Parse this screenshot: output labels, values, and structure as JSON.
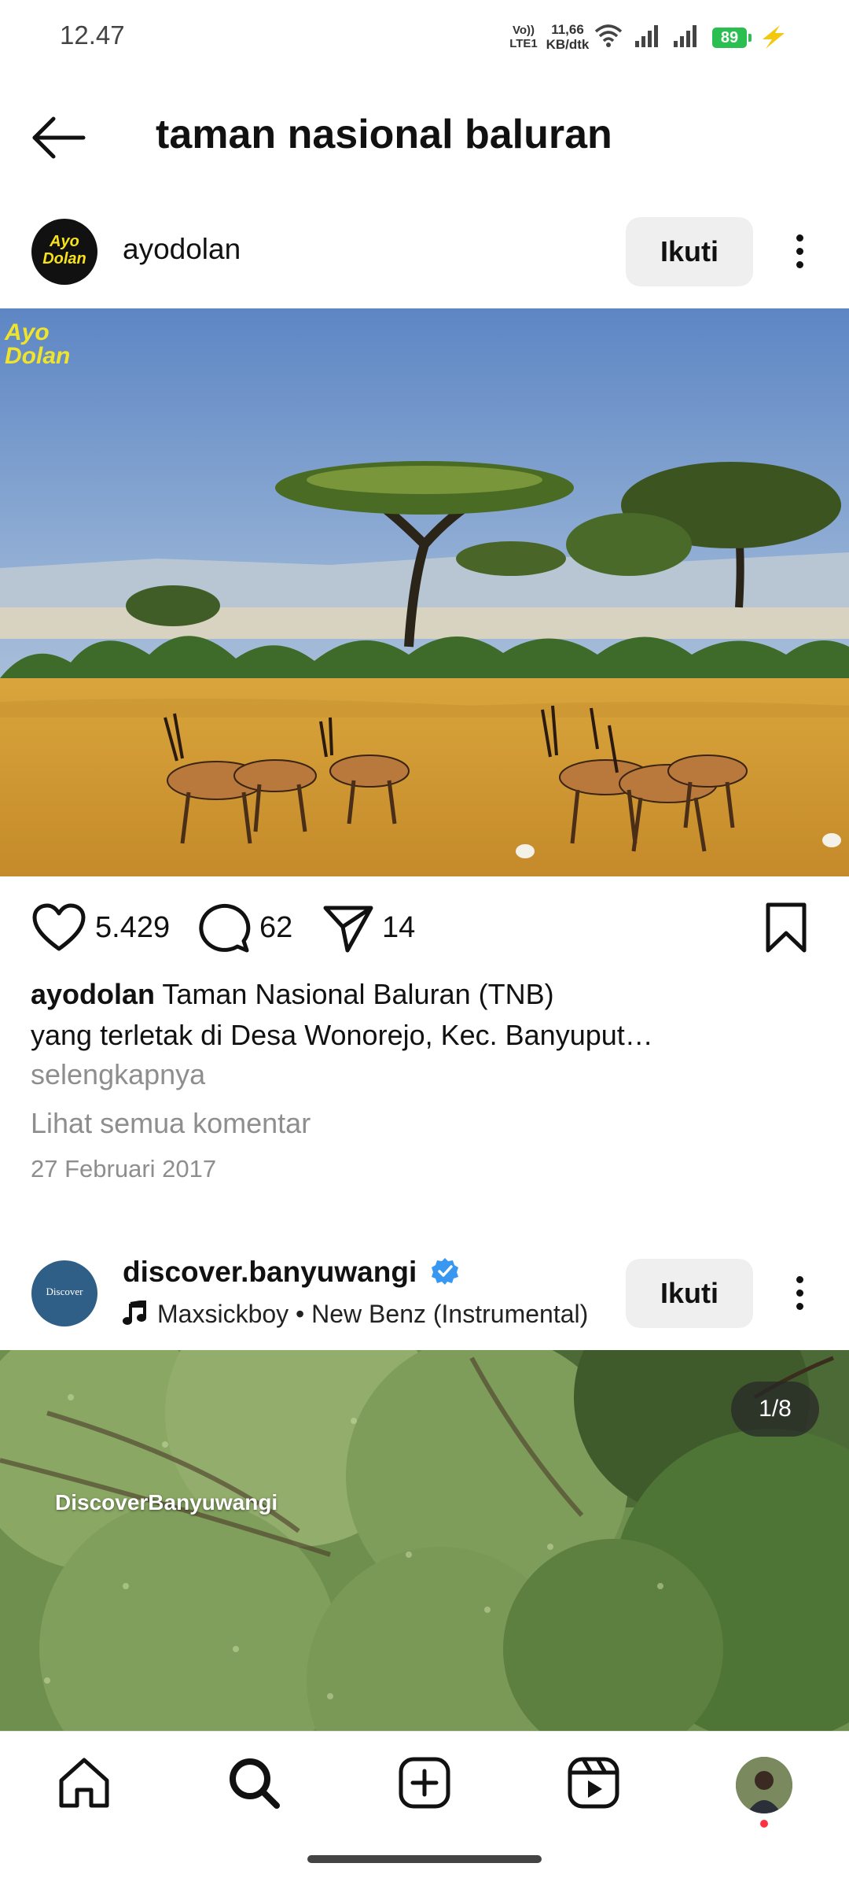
{
  "status_bar": {
    "time": "12.47",
    "volte_top": "Vo))",
    "volte_bottom": "LTE1",
    "speed_value": "11,66",
    "speed_unit": "KB/dtk",
    "battery": "89"
  },
  "header": {
    "title": "taman nasional baluran"
  },
  "post1": {
    "username": "ayodolan",
    "avatar_text": "Ayo Dolan",
    "watermark": "Ayo Dolan",
    "follow_label": "Ikuti",
    "likes": "5.429",
    "comments": "62",
    "shares": "14",
    "caption_user": "ayodolan",
    "caption_line1": "Taman Nasional Baluran (TNB)",
    "caption_line2": "yang terletak di Desa Wonorejo, Kec. Banyuput…",
    "more_label": "selengkapnya",
    "view_comments": "Lihat semua komentar",
    "date": "27 Februari 2017"
  },
  "post2": {
    "username": "discover.banyuwangi",
    "avatar_text": "Discover",
    "music": "Maxsickboy • New Benz (Instrumental)",
    "follow_label": "Ikuti",
    "page_indicator": "1/8",
    "watermark": "DiscoverBanyuwangi"
  },
  "colors": {
    "verified": "#3897f0",
    "battery": "#2bbf52",
    "notification_dot": "#ff3040",
    "charging": "#f2c811"
  }
}
